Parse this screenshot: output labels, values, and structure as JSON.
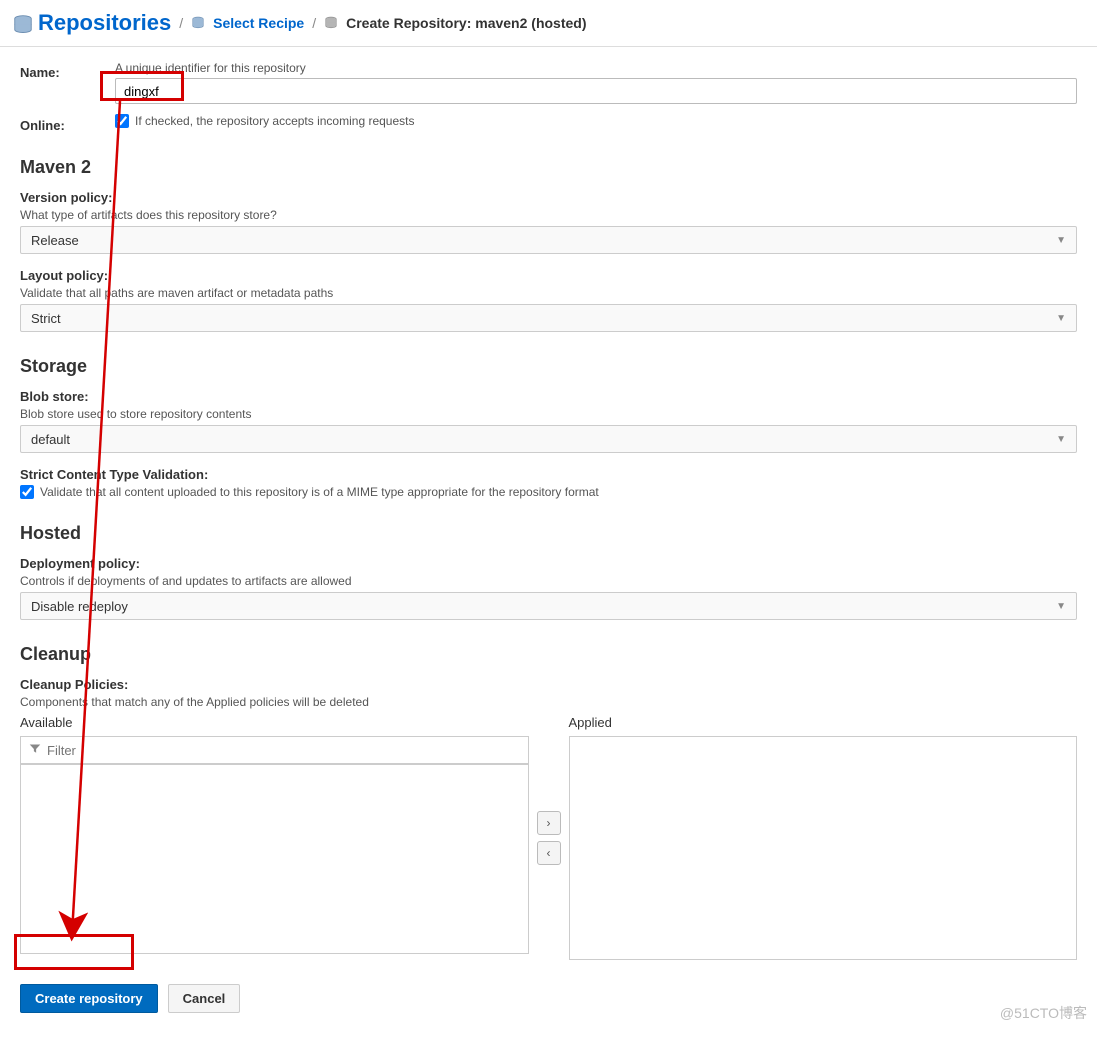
{
  "breadcrumb": {
    "repositories": "Repositories",
    "select_recipe": "Select Recipe",
    "create_repo": "Create Repository: maven2 (hosted)"
  },
  "name": {
    "label": "Name:",
    "desc": "A unique identifier for this repository",
    "value": "dingxf"
  },
  "online": {
    "label": "Online:",
    "desc": "If checked, the repository accepts incoming requests"
  },
  "maven2": {
    "title": "Maven 2",
    "version_policy": {
      "label": "Version policy:",
      "desc": "What type of artifacts does this repository store?",
      "value": "Release"
    },
    "layout_policy": {
      "label": "Layout policy:",
      "desc": "Validate that all paths are maven artifact or metadata paths",
      "value": "Strict"
    }
  },
  "storage": {
    "title": "Storage",
    "blob_store": {
      "label": "Blob store:",
      "desc": "Blob store used to store repository contents",
      "value": "default"
    },
    "strict_validation": {
      "label": "Strict Content Type Validation:",
      "desc": "Validate that all content uploaded to this repository is of a MIME type appropriate for the repository format"
    }
  },
  "hosted": {
    "title": "Hosted",
    "deployment_policy": {
      "label": "Deployment policy:",
      "desc": "Controls if deployments of and updates to artifacts are allowed",
      "value": "Disable redeploy"
    }
  },
  "cleanup": {
    "title": "Cleanup",
    "policies": {
      "label": "Cleanup Policies:",
      "desc": "Components that match any of the Applied policies will be deleted"
    },
    "available": "Available",
    "applied": "Applied",
    "filter_placeholder": "Filter"
  },
  "buttons": {
    "create": "Create repository",
    "cancel": "Cancel"
  },
  "watermark": "@51CTO博客"
}
